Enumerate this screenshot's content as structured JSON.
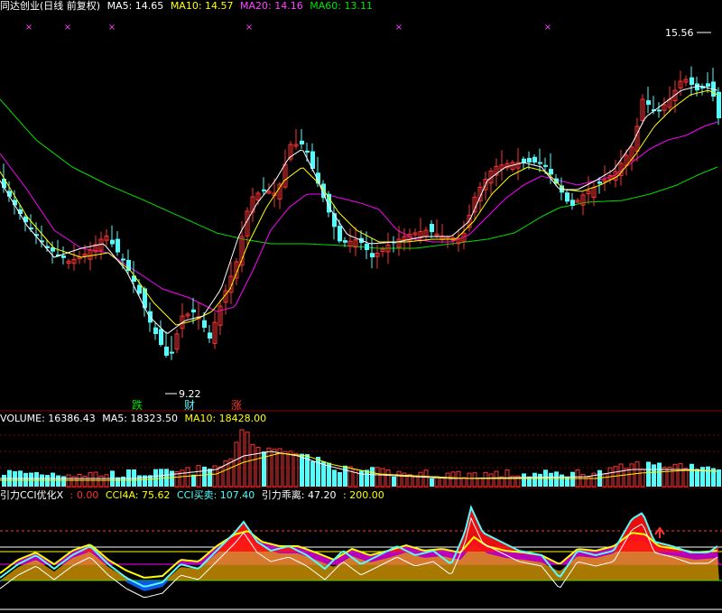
{
  "colors": {
    "up": "#ff3232",
    "down": "#54fcfc",
    "ma5": "#ffffff",
    "ma10": "#ffff00",
    "ma20": "#ff00ff",
    "ma60": "#00e000",
    "grid": "#8b0000",
    "text_white": "#ffffff",
    "text_yellow": "#ffff00",
    "text_magenta": "#ff44ff",
    "text_green": "#00e000",
    "text_red": "#ff3232",
    "text_cyan": "#54fcfc"
  },
  "main_header": {
    "title": "同达创业(日线 前复权)",
    "ma5": "MA5: 14.65",
    "ma10": "MA10: 14.57",
    "ma20": "MA20: 14.16",
    "ma60": "MA60: 13.11"
  },
  "vol_header": {
    "volume": "VOLUME: 16386.43",
    "ma5": "MA5: 18323.50",
    "ma10": "MA10: 18428.00"
  },
  "cci_header": {
    "name": "引力CCI优化X",
    "v0": ": 0.00",
    "cci4a": "CCI4A: 75.62",
    "cci_buysell": "CCI买卖: 107.40",
    "deviation": "引力乖离: 47.20",
    "v200": ": 200.00"
  },
  "annotations": {
    "high_label": "15.56",
    "low_label": "9.22",
    "tag_die": "跌",
    "tag_cai": "财",
    "tag_zhang": "涨"
  },
  "chart_data": {
    "type": "candlestick",
    "price_high": 15.56,
    "price_low": 9.22,
    "indicators": {
      "MA5": 14.65,
      "MA10": 14.57,
      "MA20": 14.16,
      "MA60": 13.11
    },
    "volume": 16386.43,
    "volume_ma5": 18323.5,
    "volume_ma10": 18428.0,
    "cci": {
      "CCI4A": 75.62,
      "CCI买卖": 107.4,
      "引力乖离": 47.2,
      "upper": 200.0,
      "zero": 0.0
    }
  }
}
